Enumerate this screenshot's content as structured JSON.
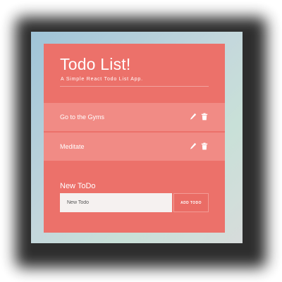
{
  "app": {
    "title": "Todo List!",
    "subtitle": "A Simple React Todo List App."
  },
  "todos": [
    {
      "text": "Go to the Gyms",
      "edit_icon": "pencil-icon",
      "delete_icon": "trash-icon"
    },
    {
      "text": "Meditate",
      "edit_icon": "pencil-icon",
      "delete_icon": "trash-icon"
    }
  ],
  "new_todo": {
    "label": "New ToDo",
    "placeholder": "New Todo",
    "button_label": "ADD TODO"
  },
  "colors": {
    "card": "#ec716a",
    "todo_row": "#f18b85",
    "input_bg": "#f5f1f0",
    "text": "#ffffff"
  }
}
